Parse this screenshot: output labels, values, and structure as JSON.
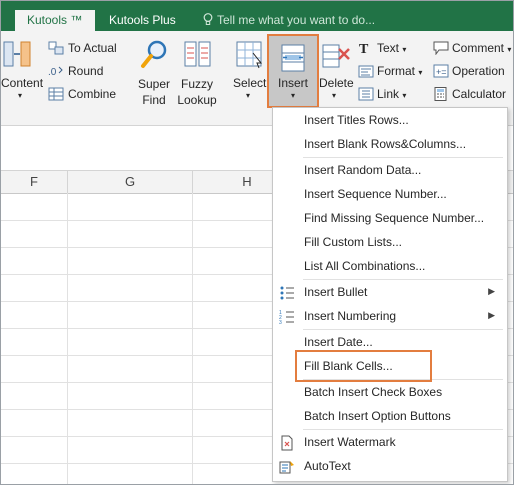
{
  "tabs": {
    "active": "Kutools ™",
    "plus": "Kutools Plus",
    "tell_me": "Tell me what you want to do..."
  },
  "ribbon": {
    "content": "Content",
    "to_actual": "To Actual",
    "round": "Round",
    "combine": "Combine",
    "super_find_1": "Super",
    "super_find_2": "Find",
    "fuzzy_lookup_1": "Fuzzy",
    "fuzzy_lookup_2": "Lookup",
    "select": "Select",
    "insert": "Insert",
    "delete": "Delete",
    "text": "Text",
    "format": "Format",
    "link": "Link",
    "comment": "Comment",
    "operation": "Operation",
    "calculator": "Calculator"
  },
  "columns": [
    "F",
    "G",
    "H"
  ],
  "menu": {
    "items": [
      "Insert Titles Rows...",
      "Insert Blank Rows&Columns...",
      "Insert Random Data...",
      "Insert Sequence Number...",
      "Find Missing Sequence Number...",
      "Fill Custom Lists...",
      "List All Combinations...",
      "Insert Bullet",
      "Insert Numbering",
      "Insert Date...",
      "Fill Blank Cells...",
      "Batch Insert Check Boxes",
      "Batch Insert Option Buttons",
      "Insert Watermark",
      "AutoText"
    ]
  },
  "colors": {
    "tab_bar": "#217346",
    "highlight": "#e37d3f",
    "ribbon_bg": "#f3f3f3"
  }
}
